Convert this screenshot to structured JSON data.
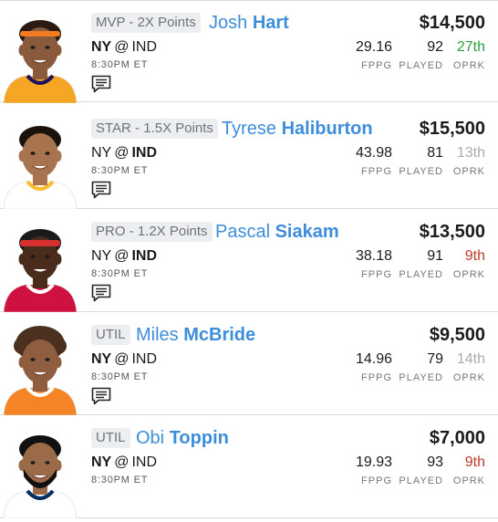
{
  "labels": {
    "fppg": "FPPG",
    "played": "PLAYED",
    "oprk": "OPRK"
  },
  "colors": {
    "name_blue": "#3d8ddb",
    "oprk_green": "#2f9e3f",
    "oprk_red": "#c0392b",
    "oprk_gray": "#a7abb2"
  },
  "players": [
    {
      "slot": "MVP - 2X Points",
      "first": "Josh",
      "last": "Hart",
      "salary": "$14,500",
      "team": "NY",
      "at": "@",
      "opp": "IND",
      "team_bold": true,
      "opp_bold": false,
      "time": "8:30PM ET",
      "fppg": "29.16",
      "played": "92",
      "oprk": "27th",
      "oprk_color": "green",
      "has_news": true,
      "jersey": "#f5a623",
      "jersey_trim": "#1d1160",
      "hair": "#2a1a12",
      "skin": "#8a5a3c",
      "accessory": "headband-orange"
    },
    {
      "slot": "STAR - 1.5X Points",
      "first": "Tyrese",
      "last": "Haliburton",
      "salary": "$15,500",
      "team": "NY",
      "at": "@",
      "opp": "IND",
      "team_bold": false,
      "opp_bold": true,
      "time": "8:30PM ET",
      "fppg": "43.98",
      "played": "81",
      "oprk": "13th",
      "oprk_color": "gray",
      "has_news": true,
      "jersey": "#ffffff",
      "jersey_trim": "#fdbb30",
      "hair": "#1a120d",
      "skin": "#a8734f",
      "accessory": "none"
    },
    {
      "slot": "PRO - 1.2X Points",
      "first": "Pascal",
      "last": "Siakam",
      "salary": "$13,500",
      "team": "NY",
      "at": "@",
      "opp": "IND",
      "team_bold": false,
      "opp_bold": true,
      "time": "8:30PM ET",
      "fppg": "38.18",
      "played": "91",
      "oprk": "9th",
      "oprk_color": "red",
      "has_news": true,
      "jersey": "#ce1141",
      "jersey_trim": "#ffffff",
      "hair": "#1a1a1a",
      "skin": "#4a2c1d",
      "accessory": "headband-red"
    },
    {
      "slot": "UTIL",
      "first": "Miles",
      "last": "McBride",
      "salary": "$9,500",
      "team": "NY",
      "at": "@",
      "opp": "IND",
      "team_bold": true,
      "opp_bold": false,
      "time": "8:30PM ET",
      "fppg": "14.96",
      "played": "79",
      "oprk": "14th",
      "oprk_color": "gray",
      "has_news": true,
      "jersey": "#f58426",
      "jersey_trim": "#ffffff",
      "hair": "#4a3020",
      "skin": "#8f5e40",
      "accessory": "curly"
    },
    {
      "slot": "UTIL",
      "first": "Obi",
      "last": "Toppin",
      "salary": "$7,000",
      "team": "NY",
      "at": "@",
      "opp": "IND",
      "team_bold": true,
      "opp_bold": false,
      "time": "8:30PM ET",
      "fppg": "19.93",
      "played": "93",
      "oprk": "9th",
      "oprk_color": "red",
      "has_news": false,
      "jersey": "#ffffff",
      "jersey_trim": "#002d62",
      "hair": "#111111",
      "skin": "#9b6a48",
      "accessory": "beard"
    }
  ]
}
